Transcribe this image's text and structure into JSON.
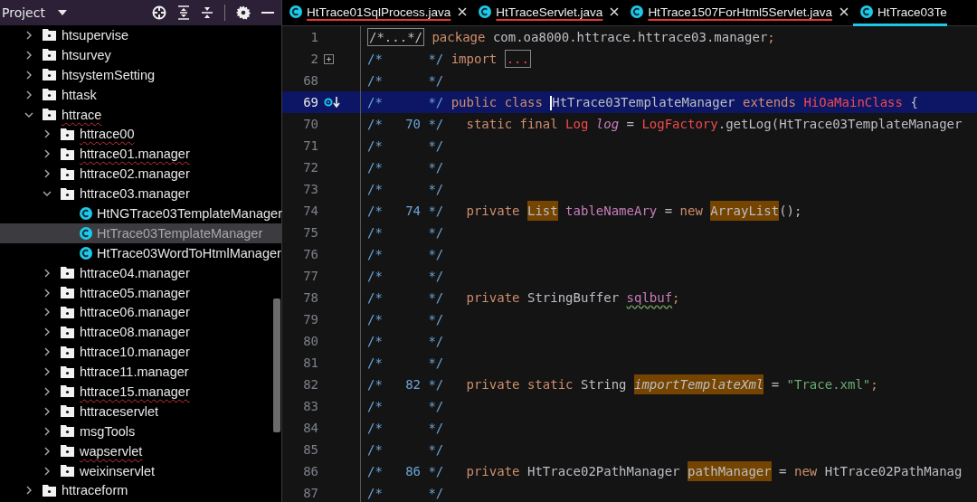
{
  "project_panel": {
    "title": "Project"
  },
  "tree": [
    {
      "label": "htsupervise",
      "kind": "folder",
      "expanded": false,
      "selected": false,
      "error": false
    },
    {
      "label": "htsurvey",
      "kind": "folder",
      "expanded": false,
      "selected": false,
      "error": false
    },
    {
      "label": "htsystemSetting",
      "kind": "folder",
      "expanded": false,
      "selected": false,
      "error": false
    },
    {
      "label": "httask",
      "kind": "folder",
      "expanded": false,
      "selected": false,
      "error": false
    },
    {
      "label": "httrace",
      "kind": "folder",
      "expanded": true,
      "selected": false,
      "error": true,
      "children": [
        {
          "label": "httrace00",
          "kind": "folder",
          "expanded": false,
          "selected": false,
          "error": true
        },
        {
          "label": "httrace01.manager",
          "kind": "folder",
          "expanded": false,
          "selected": false,
          "error": true
        },
        {
          "label": "httrace02.manager",
          "kind": "folder",
          "expanded": false,
          "selected": false,
          "error": false
        },
        {
          "label": "httrace03.manager",
          "kind": "folder",
          "expanded": true,
          "selected": false,
          "error": false,
          "children": [
            {
              "label": "HtNGTrace03TemplateManager",
              "kind": "class",
              "selected": false,
              "error": false
            },
            {
              "label": "HtTrace03TemplateManager",
              "kind": "class",
              "selected": true,
              "error": false
            },
            {
              "label": "HtTrace03WordToHtmlManager",
              "kind": "class",
              "selected": false,
              "error": false
            }
          ]
        },
        {
          "label": "httrace04.manager",
          "kind": "folder",
          "expanded": false,
          "selected": false,
          "error": false
        },
        {
          "label": "httrace05.manager",
          "kind": "folder",
          "expanded": false,
          "selected": false,
          "error": false
        },
        {
          "label": "httrace06.manager",
          "kind": "folder",
          "expanded": false,
          "selected": false,
          "error": false
        },
        {
          "label": "httrace08.manager",
          "kind": "folder",
          "expanded": false,
          "selected": false,
          "error": false
        },
        {
          "label": "httrace10.manager",
          "kind": "folder",
          "expanded": false,
          "selected": false,
          "error": false
        },
        {
          "label": "httrace11.manager",
          "kind": "folder",
          "expanded": false,
          "selected": false,
          "error": false
        },
        {
          "label": "httrace15.manager",
          "kind": "folder",
          "expanded": false,
          "selected": false,
          "error": true
        },
        {
          "label": "httraceservlet",
          "kind": "folder",
          "expanded": false,
          "selected": false,
          "error": false
        },
        {
          "label": "msgTools",
          "kind": "folder",
          "expanded": false,
          "selected": false,
          "error": false
        },
        {
          "label": "wapservlet",
          "kind": "folder",
          "expanded": false,
          "selected": false,
          "error": true
        },
        {
          "label": "weixinservlet",
          "kind": "folder",
          "expanded": false,
          "selected": false,
          "error": false
        }
      ]
    },
    {
      "label": "httraceform",
      "kind": "folder",
      "expanded": false,
      "selected": false,
      "error": false
    }
  ],
  "tabs": [
    {
      "label": "HtTrace01SqlProcess.java",
      "selected": false,
      "error": true,
      "closable": true
    },
    {
      "label": "HtTraceServlet.java",
      "selected": false,
      "error": true,
      "closable": true
    },
    {
      "label": "HtTrace1507ForHtml5Servlet.java",
      "selected": false,
      "error": true,
      "closable": true
    },
    {
      "label": "HtTrace03Te",
      "selected": true,
      "error": false,
      "closable": false
    }
  ],
  "code_lines": [
    {
      "number": "1",
      "tokens": [
        {
          "kind": "fold",
          "t": "/*...*/"
        },
        {
          "kind": "kw",
          "t": " package"
        },
        {
          "kind": "plain",
          "t": " com.oa8000.httrace.httrace03.manager"
        },
        {
          "kind": "kw",
          "t": ";"
        }
      ]
    },
    {
      "number": "2",
      "gutter": {
        "kind": "fold"
      },
      "open": "/*",
      "close": "*/",
      "tokens": [
        {
          "kind": "kw",
          "t": "import "
        },
        {
          "kind": "foldref",
          "t": "..."
        }
      ]
    },
    {
      "number": "68",
      "open": "/*",
      "close": "*/"
    },
    {
      "number": "69",
      "gutter": {
        "kind": "override"
      },
      "current": true,
      "open": "/*",
      "close": "*/",
      "tokens": [
        {
          "kind": "kw",
          "t": "public class "
        },
        {
          "kind": "plain",
          "t": "HtTrace03TemplateManager",
          "cursor": true
        },
        {
          "kind": "kw",
          "t": " extends "
        },
        {
          "kind": "type",
          "t": "HiOaMainClass"
        },
        {
          "kind": "plain",
          "t": " {"
        }
      ]
    },
    {
      "number": "70",
      "open": "/*",
      "orig": "70",
      "close": "*/",
      "indented": true,
      "tokens": [
        {
          "kind": "kw",
          "t": "static final "
        },
        {
          "kind": "type",
          "t": "Log"
        },
        {
          "kind": "fieldi",
          "t": " log"
        },
        {
          "kind": "plain",
          "t": " = "
        },
        {
          "kind": "type",
          "t": "LogFactory"
        },
        {
          "kind": "plain",
          "t": ".getLog(HtTrace03TemplateManager"
        }
      ]
    },
    {
      "number": "71",
      "open": "/*",
      "close": "*/"
    },
    {
      "number": "72",
      "open": "/*",
      "close": "*/"
    },
    {
      "number": "73",
      "open": "/*",
      "close": "*/"
    },
    {
      "number": "74",
      "open": "/*",
      "orig": "74",
      "close": "*/",
      "indented": true,
      "tokens": [
        {
          "kind": "kw",
          "t": "private "
        },
        {
          "kind": "hl",
          "t": "List"
        },
        {
          "kind": "field",
          "t": " tableNameAry"
        },
        {
          "kind": "plain",
          "t": " = "
        },
        {
          "kind": "kw",
          "t": "new "
        },
        {
          "kind": "hl",
          "t": "ArrayList"
        },
        {
          "kind": "plain",
          "t": "();"
        }
      ]
    },
    {
      "number": "75",
      "open": "/*",
      "close": "*/"
    },
    {
      "number": "76",
      "open": "/*",
      "close": "*/"
    },
    {
      "number": "77",
      "open": "/*",
      "close": "*/"
    },
    {
      "number": "78",
      "open": "/*",
      "close": "*/",
      "indented": true,
      "tokens": [
        {
          "kind": "kw",
          "t": "private "
        },
        {
          "kind": "plain",
          "t": "StringBuffer "
        },
        {
          "kind": "warn",
          "t": "sqlbuf"
        },
        {
          "kind": "kw",
          "t": ";"
        }
      ]
    },
    {
      "number": "79",
      "open": "/*",
      "close": "*/"
    },
    {
      "number": "80",
      "open": "/*",
      "close": "*/"
    },
    {
      "number": "81",
      "open": "/*",
      "close": "*/"
    },
    {
      "number": "82",
      "open": "/*",
      "orig": "82",
      "close": "*/",
      "indented": true,
      "tokens": [
        {
          "kind": "kw",
          "t": "private static "
        },
        {
          "kind": "plain",
          "t": "String "
        },
        {
          "kind": "hli",
          "t": "importTemplateXml"
        },
        {
          "kind": "plain",
          "t": " = "
        },
        {
          "kind": "str",
          "t": "\"Trace.xml\""
        },
        {
          "kind": "kw",
          "t": ";"
        }
      ]
    },
    {
      "number": "83",
      "open": "/*",
      "close": "*/"
    },
    {
      "number": "84",
      "open": "/*",
      "close": "*/"
    },
    {
      "number": "85",
      "open": "/*",
      "close": "*/"
    },
    {
      "number": "86",
      "open": "/*",
      "orig": "86",
      "close": "*/",
      "indented": true,
      "tokens": [
        {
          "kind": "kw",
          "t": "private "
        },
        {
          "kind": "plain",
          "t": "HtTrace02PathManager "
        },
        {
          "kind": "hl",
          "t": "pathManager"
        },
        {
          "kind": "plain",
          "t": " = "
        },
        {
          "kind": "kw",
          "t": "new "
        },
        {
          "kind": "plain",
          "t": "HtTrace02PathManag"
        }
      ]
    },
    {
      "number": "87",
      "open": "/*",
      "close": "*/"
    }
  ]
}
